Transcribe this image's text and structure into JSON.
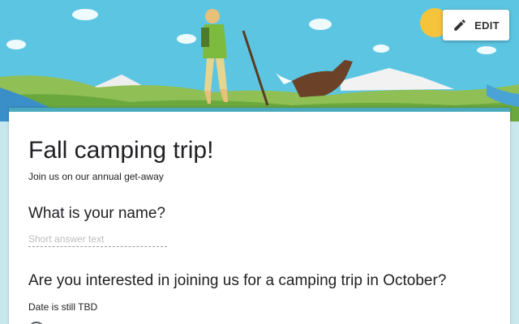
{
  "header": {
    "edit_label": "EDIT",
    "edit_icon": "pencil-icon",
    "theme_color": "#49a9bd"
  },
  "form": {
    "title": "Fall camping trip!",
    "description": "Join us on our annual get-away",
    "questions": [
      {
        "title": "What is your name?",
        "type": "short-answer",
        "placeholder": "Short answer text"
      },
      {
        "title": "Are you interested in joining us for a camping trip in October?",
        "description": "Date is still TBD",
        "type": "multiple-choice"
      }
    ]
  }
}
